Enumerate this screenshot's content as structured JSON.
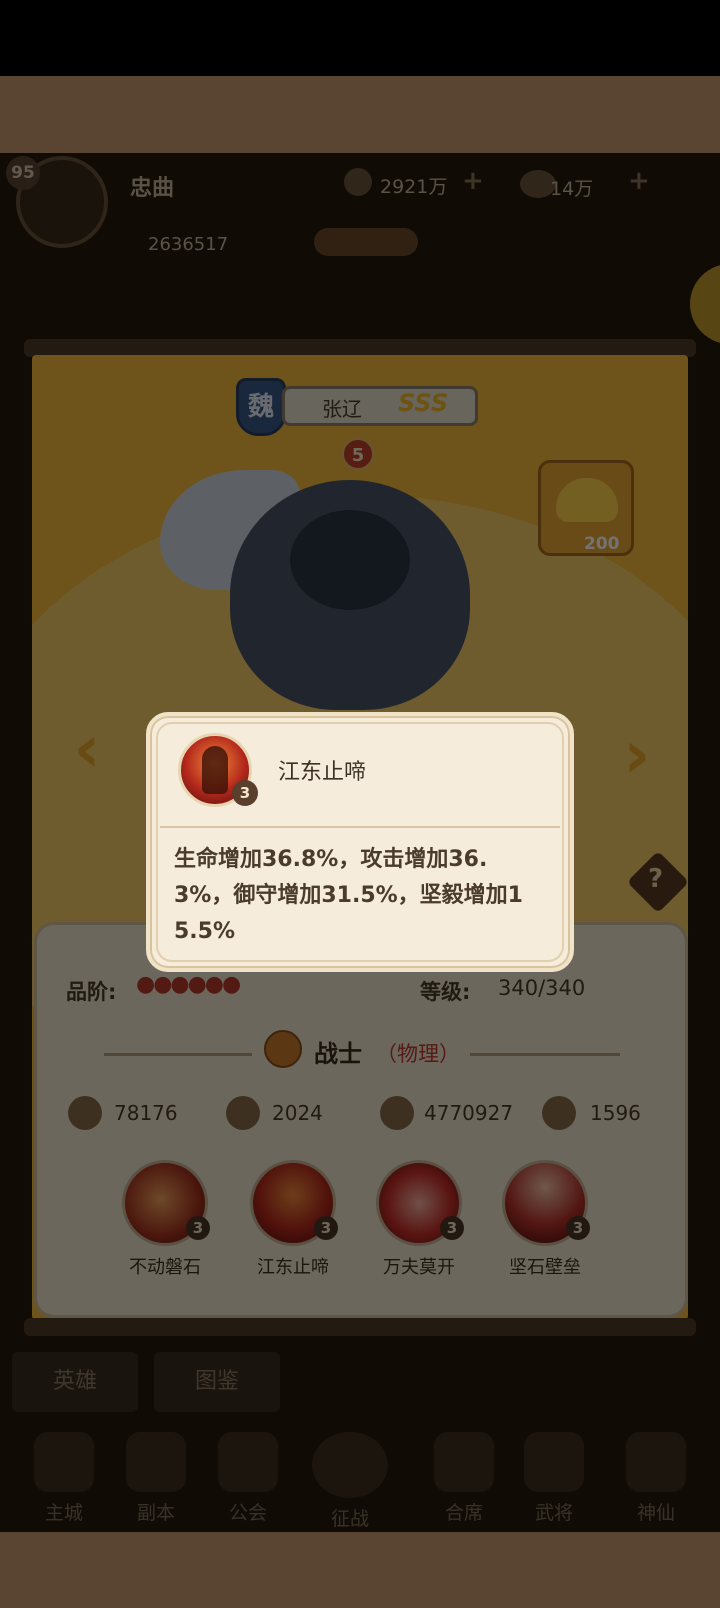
{
  "header": {
    "player_level": "95",
    "player_name": "忠曲",
    "combat_power": "2636517",
    "currency_1": "2921万",
    "currency_2": "14万"
  },
  "hero": {
    "faction": "魏",
    "name": "张辽",
    "grade": "SSS",
    "stars": "5",
    "ingot_count": "200"
  },
  "info": {
    "grade_label": "品阶:",
    "level_label": "等级:",
    "level_value": "340/340",
    "class_name": "战士",
    "class_type": "（物理）",
    "stats": [
      {
        "icon": "sword-icon",
        "value": "78176"
      },
      {
        "icon": "shield-icon",
        "value": "2024"
      },
      {
        "icon": "heart-icon",
        "value": "4770927"
      },
      {
        "icon": "boot-icon",
        "value": "1596"
      }
    ],
    "skills": [
      {
        "name": "不动磐石",
        "level": "3"
      },
      {
        "name": "江东止啼",
        "level": "3"
      },
      {
        "name": "万夫莫开",
        "level": "3"
      },
      {
        "name": "坚石壁垒",
        "level": "3"
      }
    ]
  },
  "tabs": [
    "英雄",
    "图鉴"
  ],
  "bottom_nav": [
    "主城",
    "副本",
    "公会",
    "征战",
    "合席",
    "武将",
    "神仙"
  ],
  "popup": {
    "skill_name": "江东止啼",
    "skill_level": "3",
    "description": "生命增加36.8%，攻击增加36.3%，御守增加31.5%，坚毅增加15.5%"
  },
  "colors": {
    "card_gold": "#f4b93a",
    "popup_bg": "#f6ecdc",
    "accent_red": "#c0392b",
    "band_brown": "#5a4432"
  }
}
